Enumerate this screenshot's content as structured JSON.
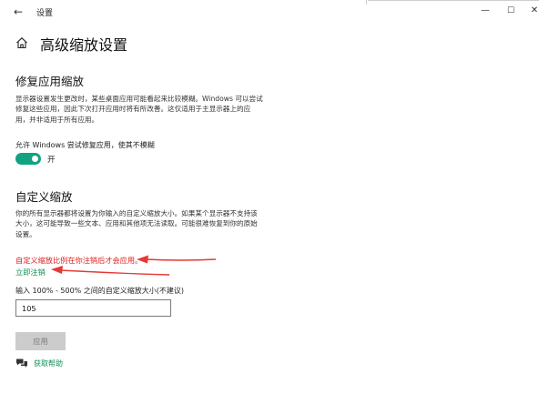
{
  "titlebar": {
    "back_icon": "back-arrow-icon",
    "title": "设置",
    "minimize_icon": "minimize-icon",
    "maximize_icon": "maximize-icon",
    "close_icon": "close-icon"
  },
  "header": {
    "home_icon": "home-icon",
    "title": "高级缩放设置"
  },
  "fix_scaling": {
    "title": "修复应用缩放",
    "description": "显示器设置发生更改时，某些桌面应用可能看起来比较模糊。Windows 可以尝试修复这些应用，因此下次打开应用时将有所改善。这仅适用于主显示器上的应用，并非适用于所有应用。",
    "toggle_label": "允许 Windows 尝试修复应用，使其不模糊",
    "toggle_state": "开",
    "toggle_on": true
  },
  "custom_scaling": {
    "title": "自定义缩放",
    "description": "你的所有显示器都将设置为你输入的自定义缩放大小。如果某个显示器不支持该大小，这可能导致一些文本、应用和其他项无法读取。可能很难恢复到你的原始设置。",
    "warning": "自定义缩放比例在你注销后才会应用。",
    "signout_link": "立即注销",
    "input_label": "输入 100% - 500% 之间的自定义缩放大小(不建议)",
    "input_value": "105",
    "apply_label": "应用"
  },
  "help": {
    "icon": "chat-bubble-icon",
    "link": "获取帮助"
  },
  "colors": {
    "accent": "#11a37f",
    "link": "#0f8f54",
    "warning": "#e02020",
    "annotation_arrow": "#e53935"
  }
}
